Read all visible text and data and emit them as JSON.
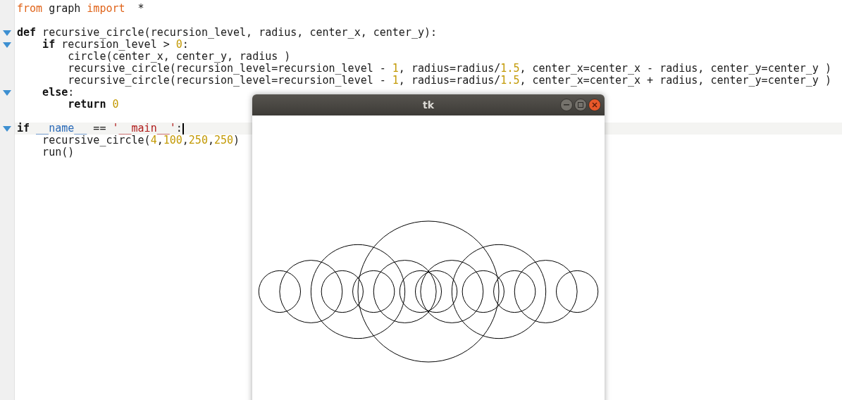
{
  "editor": {
    "lines": [
      {
        "fold": false,
        "current": false,
        "tokens": [
          {
            "kind": "import",
            "text": "from"
          },
          {
            "kind": "plain",
            "text": " graph "
          },
          {
            "kind": "import",
            "text": "import"
          },
          {
            "kind": "plain",
            "text": "  *"
          }
        ]
      },
      {
        "fold": false,
        "current": false
      },
      {
        "fold": true,
        "current": false,
        "tokens": [
          {
            "kind": "keyword",
            "text": "def"
          },
          {
            "kind": "plain",
            "text": " recursive_circle(recursion_level, radius, center_x, center_y):"
          }
        ]
      },
      {
        "fold": true,
        "current": false,
        "tokens": [
          {
            "kind": "keyword",
            "text": "    if"
          },
          {
            "kind": "plain",
            "text": " recursion_level > "
          },
          {
            "kind": "number",
            "text": "0"
          },
          {
            "kind": "plain",
            "text": ":"
          }
        ]
      },
      {
        "fold": false,
        "current": false,
        "tokens": [
          {
            "kind": "plain",
            "text": "        circle(center_x, center_y, radius )"
          }
        ]
      },
      {
        "fold": false,
        "current": false,
        "tokens": [
          {
            "kind": "plain",
            "text": "        recursive_circle(recursion_level=recursion_level - "
          },
          {
            "kind": "number",
            "text": "1"
          },
          {
            "kind": "plain",
            "text": ", radius=radius/"
          },
          {
            "kind": "number",
            "text": "1.5"
          },
          {
            "kind": "plain",
            "text": ", center_x=center_x - radius, center_y=center_y )"
          }
        ]
      },
      {
        "fold": false,
        "current": false,
        "tokens": [
          {
            "kind": "plain",
            "text": "        recursive_circle(recursion_level=recursion_level - "
          },
          {
            "kind": "number",
            "text": "1"
          },
          {
            "kind": "plain",
            "text": ", radius=radius/"
          },
          {
            "kind": "number",
            "text": "1.5"
          },
          {
            "kind": "plain",
            "text": ", center_x=center_x + radius, center_y=center_y )"
          }
        ]
      },
      {
        "fold": true,
        "current": false,
        "tokens": [
          {
            "kind": "keyword",
            "text": "    else"
          },
          {
            "kind": "plain",
            "text": ":"
          }
        ]
      },
      {
        "fold": false,
        "current": false,
        "tokens": [
          {
            "kind": "keyword",
            "text": "        return"
          },
          {
            "kind": "number",
            "text": " 0"
          }
        ]
      },
      {
        "fold": false,
        "current": false
      },
      {
        "fold": true,
        "current": true,
        "tokens": [
          {
            "kind": "keyword",
            "text": "if"
          },
          {
            "kind": "name",
            "text": " __name__"
          },
          {
            "kind": "plain",
            "text": " == "
          },
          {
            "kind": "string",
            "text": "'__main__'"
          },
          {
            "kind": "plain",
            "text": ":"
          }
        ]
      },
      {
        "fold": false,
        "current": false,
        "tokens": [
          {
            "kind": "plain",
            "text": "    recursive_circle("
          },
          {
            "kind": "number",
            "text": "4"
          },
          {
            "kind": "plain",
            "text": ","
          },
          {
            "kind": "number",
            "text": "100"
          },
          {
            "kind": "plain",
            "text": ","
          },
          {
            "kind": "number",
            "text": "250"
          },
          {
            "kind": "plain",
            "text": ","
          },
          {
            "kind": "number",
            "text": "250"
          },
          {
            "kind": "plain",
            "text": ")"
          }
        ]
      },
      {
        "fold": false,
        "current": false,
        "tokens": [
          {
            "kind": "plain",
            "text": "    run()"
          }
        ]
      }
    ]
  },
  "window": {
    "title": "tk"
  }
}
